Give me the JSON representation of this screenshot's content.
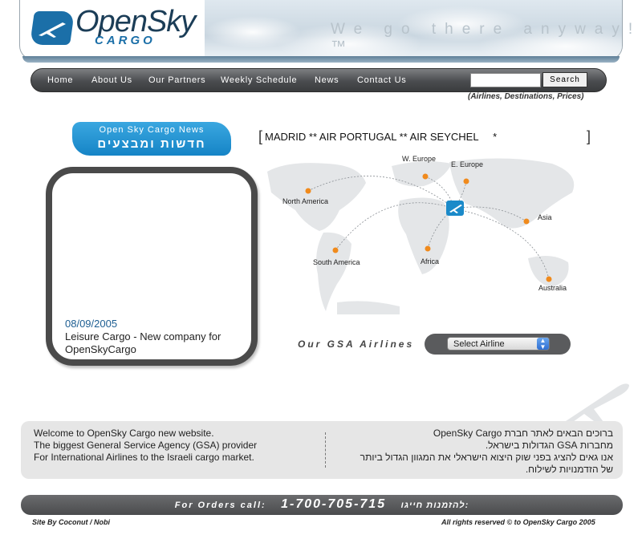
{
  "header": {
    "logo_text": "OpenSky",
    "logo_sub": "CARGO",
    "tagline": "We go there anyway!™"
  },
  "nav": {
    "items": [
      {
        "label": "Home"
      },
      {
        "label": "About Us"
      },
      {
        "label": "Our Partners"
      },
      {
        "label": "Weekly Schedule"
      },
      {
        "label": "News"
      },
      {
        "label": "Contact Us"
      }
    ],
    "search_value": "",
    "search_button": "Search",
    "search_hint": "(Airlines, Destinations, Prices)"
  },
  "news": {
    "title_en": "Open Sky Cargo News",
    "title_he": "חדשות ומבצעים",
    "date": "08/09/2005",
    "text": "Leisure Cargo - New company for OpenSkyCargo"
  },
  "ticker": {
    "text": "MADRID ** AIR PORTUGAL ** AIR SEYCHEL     *"
  },
  "map": {
    "regions": [
      "North America",
      "W. Europe",
      "E. Europe",
      "Asia",
      "South America",
      "Africa",
      "Australia"
    ]
  },
  "gsa": {
    "label": "Our GSA Airlines",
    "select_value": "Select Airline"
  },
  "welcome": {
    "en": [
      "Welcome to OpenSky Cargo new website.",
      "The biggest General Service Agency (GSA) provider",
      "For International Airlines to the Israeli cargo market."
    ],
    "he": [
      "ברוכים הבאים לאתר חברת OpenSky Cargo",
      "מחברות GSA הגדולות בישראל.",
      "אנו גאים להציג בפני שוק היצוא הישראלי את המגוון הגדול ביותר",
      "של הזדמנויות לשילוח."
    ]
  },
  "footer": {
    "order_label": "For Orders call:",
    "phone": "1-700-705-715",
    "order_he": "להזמנות חייגו:",
    "credit_left": "Site By Coconut / Nobi",
    "credit_right": "All rights reserved © to OpenSky Cargo 2005"
  },
  "colors": {
    "brand_blue": "#1b6fa8",
    "news_blue": "#1584c6",
    "nav_dark": "#4a4c4f",
    "map_dot": "#f08a1c"
  }
}
